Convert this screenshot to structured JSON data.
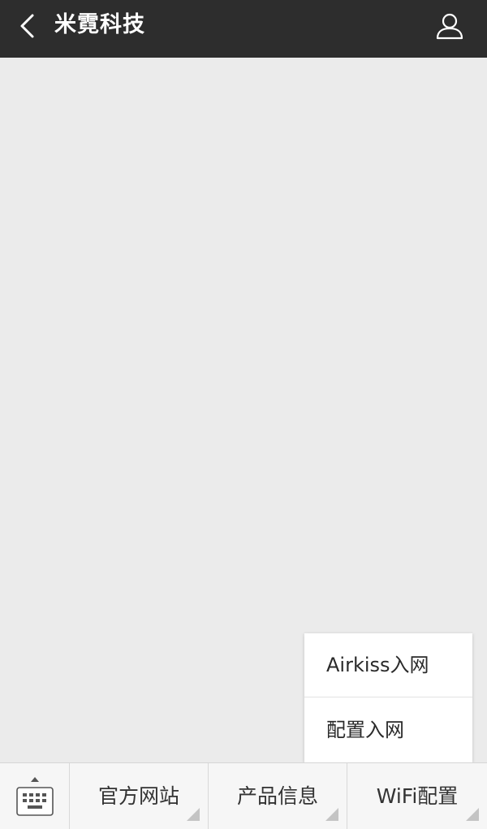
{
  "header": {
    "title": "米霓科技",
    "back_icon": "chevron-left-icon",
    "profile_icon": "person-icon",
    "background_color": "#2d2d2d"
  },
  "chat": {
    "background_color": "#ebebeb"
  },
  "popup_menu": {
    "items": [
      {
        "label": "Airkiss入网"
      },
      {
        "label": "配置入网"
      }
    ]
  },
  "bottom_menu": {
    "keyboard_icon": "keyboard-icon",
    "buttons": [
      {
        "label": "官方网站"
      },
      {
        "label": "产品信息"
      },
      {
        "label": "WiFi配置"
      }
    ]
  }
}
